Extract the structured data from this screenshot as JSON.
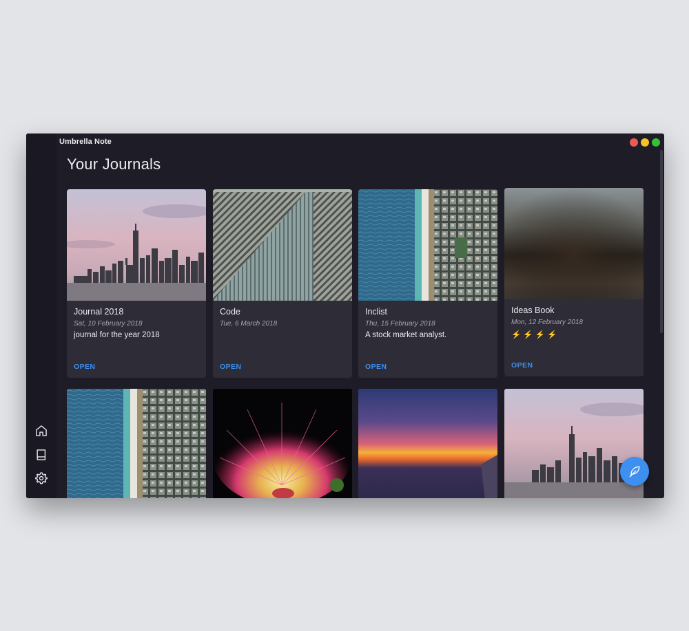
{
  "app": {
    "title": "Umbrella Note"
  },
  "window_controls": {
    "close_color": "#ee5a52",
    "minimize_color": "#f6c22a",
    "maximize_color": "#33c23a"
  },
  "page": {
    "title": "Your Journals"
  },
  "sidebar": {
    "items": [
      {
        "icon": "home-icon"
      },
      {
        "icon": "book-icon"
      },
      {
        "icon": "gear-icon"
      }
    ]
  },
  "journals": [
    {
      "name": "Journal 2018",
      "date": "Sat, 10 February 2018",
      "description": "journal for the year 2018",
      "action": "OPEN",
      "cover": "city-skyline"
    },
    {
      "name": "Code",
      "date": "Tue, 6 March 2018",
      "description": "",
      "action": "OPEN",
      "cover": "striped-architecture"
    },
    {
      "name": "Inclist",
      "date": "Thu, 15 February 2018",
      "description": "A stock market analyst.",
      "action": "OPEN",
      "cover": "aerial-coast"
    },
    {
      "name": "Ideas Book",
      "date": "Mon, 12 February 2018",
      "description": "⚡⚡⚡⚡",
      "action": "OPEN",
      "cover": "blurred"
    }
  ],
  "second_row_covers": [
    "aerial-coast",
    "pink-flower",
    "sunset",
    "city-skyline"
  ],
  "accent_color": "#3d8ff0",
  "fab": {
    "icon": "feather-icon"
  }
}
